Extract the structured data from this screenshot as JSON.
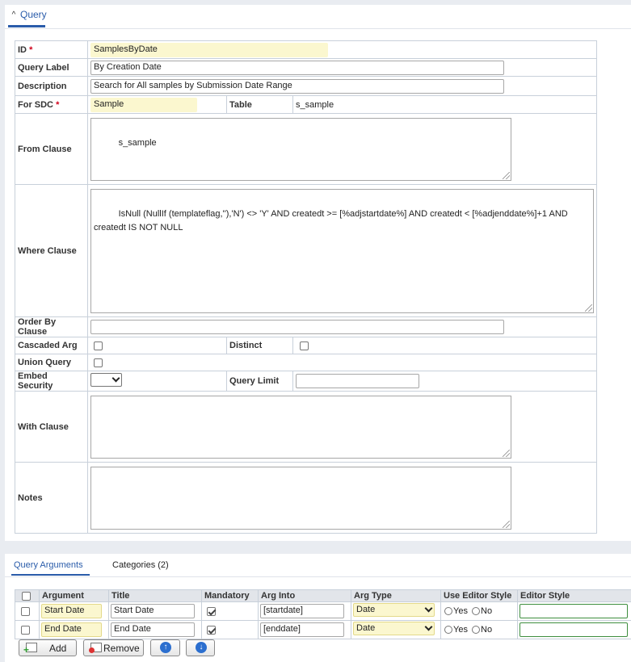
{
  "query_section": {
    "title": "Query",
    "toggle_icon": "chevron-up-icon"
  },
  "form": {
    "id_label": "ID",
    "id_value": "SamplesByDate",
    "query_label_label": "Query Label",
    "query_label_value": "By Creation Date",
    "description_label": "Description",
    "description_value": "Search for All samples by Submission Date Range",
    "for_sdc_label": "For SDC",
    "for_sdc_value": "Sample",
    "table_label": "Table",
    "table_value": "s_sample",
    "from_clause_label": "From Clause",
    "from_clause_value": "s_sample",
    "where_clause_label": "Where Clause",
    "where_clause_value": "IsNull (NullIf (templateflag,''),'N') <> 'Y' AND createdt >= [%adjstartdate%] AND createdt < [%adjenddate%]+1 AND createdt IS NOT NULL",
    "order_by_label": "Order By Clause",
    "order_by_value": "",
    "cascaded_arg_label": "Cascaded Arg",
    "distinct_label": "Distinct",
    "union_query_label": "Union Query",
    "embed_security_label": "Embed Security",
    "embed_security_value": "",
    "query_limit_label": "Query Limit",
    "query_limit_value": "",
    "with_clause_label": "With Clause",
    "with_clause_value": "",
    "notes_label": "Notes",
    "notes_value": "",
    "required_mark": "*"
  },
  "tabs": {
    "arguments": "Query Arguments",
    "categories": "Categories (2)"
  },
  "grid": {
    "headers": [
      "Argument",
      "Title",
      "Mandatory",
      "Arg Into",
      "Arg Type",
      "Use Editor Style",
      "Editor Style"
    ],
    "rows": [
      {
        "argument": "Start Date",
        "title": "Start Date",
        "mandatory": true,
        "arg_into": "[startdate]",
        "arg_type": "Date",
        "yes": "Yes",
        "no": "No",
        "editor_style": ""
      },
      {
        "argument": "End Date",
        "title": "End Date",
        "mandatory": true,
        "arg_into": "[enddate]",
        "arg_type": "Date",
        "yes": "Yes",
        "no": "No",
        "editor_style": ""
      }
    ]
  },
  "buttons": {
    "add": "Add",
    "remove": "Remove",
    "move_up_icon": "arrow-up-icon",
    "move_down_icon": "arrow-down-icon"
  },
  "colors": {
    "accent": "#2a5caa",
    "key_field": "#fbf7cf",
    "required": "#d0021b"
  }
}
